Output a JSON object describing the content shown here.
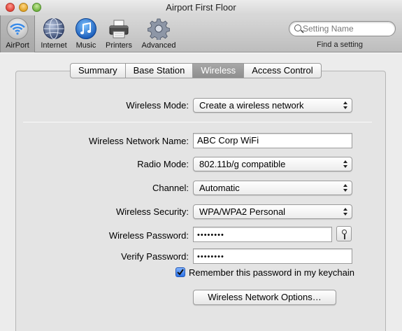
{
  "window": {
    "title": "Airport First Floor"
  },
  "toolbar": {
    "items": [
      {
        "label": "AirPort",
        "icon": "airport-wifi-icon",
        "selected": true
      },
      {
        "label": "Internet",
        "icon": "globe-icon",
        "selected": false
      },
      {
        "label": "Music",
        "icon": "music-note-icon",
        "selected": false
      },
      {
        "label": "Printers",
        "icon": "printer-icon",
        "selected": false
      },
      {
        "label": "Advanced",
        "icon": "gear-icon",
        "selected": false
      }
    ],
    "search": {
      "placeholder": "Setting Name",
      "hint": "Find a setting"
    }
  },
  "tabs": [
    {
      "label": "Summary",
      "active": false
    },
    {
      "label": "Base Station",
      "active": false
    },
    {
      "label": "Wireless",
      "active": true
    },
    {
      "label": "Access Control",
      "active": false
    }
  ],
  "form": {
    "wireless_mode": {
      "label": "Wireless Mode:",
      "value": "Create a wireless network"
    },
    "network_name": {
      "label": "Wireless Network Name:",
      "value": "ABC Corp WiFi"
    },
    "radio_mode": {
      "label": "Radio Mode:",
      "value": "802.11b/g compatible"
    },
    "channel": {
      "label": "Channel:",
      "value": "Automatic"
    },
    "security": {
      "label": "Wireless Security:",
      "value": "WPA/WPA2 Personal"
    },
    "password": {
      "label": "Wireless Password:",
      "value": "••••••••"
    },
    "verify_password": {
      "label": "Verify Password:",
      "value": "••••••••"
    },
    "keychain": {
      "label": "Remember this password in my keychain",
      "checked": true
    },
    "options_button": "Wireless Network Options…"
  },
  "colors": {
    "accent": "#2b72e6",
    "active_tab": "#999999"
  }
}
